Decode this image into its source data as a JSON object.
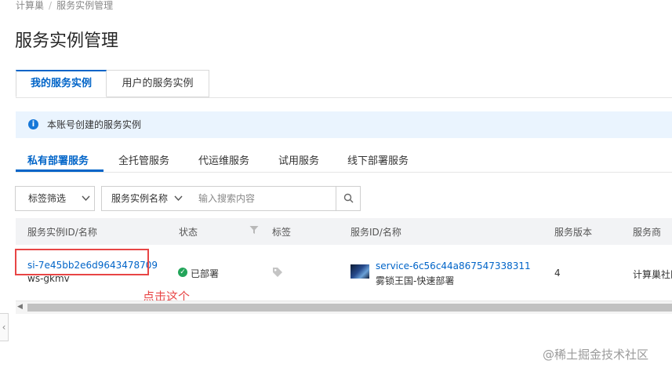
{
  "breadcrumb": {
    "items": [
      "计算巢",
      "服务实例管理"
    ],
    "separator": "/"
  },
  "page": {
    "title": "服务实例管理"
  },
  "tabs": [
    {
      "label": "我的服务实例",
      "active": true
    },
    {
      "label": "用户的服务实例",
      "active": false
    }
  ],
  "notice": {
    "icon": "info-icon",
    "text": "本账号创建的服务实例"
  },
  "subtabs": [
    {
      "label": "私有部署服务",
      "active": true
    },
    {
      "label": "全托管服务",
      "active": false
    },
    {
      "label": "代运维服务",
      "active": false
    },
    {
      "label": "试用服务",
      "active": false
    },
    {
      "label": "线下部署服务",
      "active": false
    }
  ],
  "filters": {
    "tag_filter_label": "标签筛选",
    "field_select_label": "服务实例名称",
    "search_placeholder": "输入搜索内容"
  },
  "table": {
    "columns": [
      "服务实例ID/名称",
      "状态",
      "标签",
      "服务ID/名称",
      "服务版本",
      "服务商"
    ],
    "rows": [
      {
        "instance_id": "si-7e45bb2e6d9643478709",
        "instance_name": "ws-gkmv",
        "status": "已部署",
        "service_id": "service-6c56c44a867547338311",
        "service_name": "雾锁王国-快速部署",
        "version": "4",
        "provider": "计算巢社区"
      }
    ]
  },
  "annotation": {
    "text": "点击这个",
    "color": "#e84545"
  },
  "watermark": "@稀土掘金技术社区",
  "colors": {
    "accent": "#0064c8",
    "success": "#23a55a",
    "notice_bg": "#eaf4fe"
  }
}
